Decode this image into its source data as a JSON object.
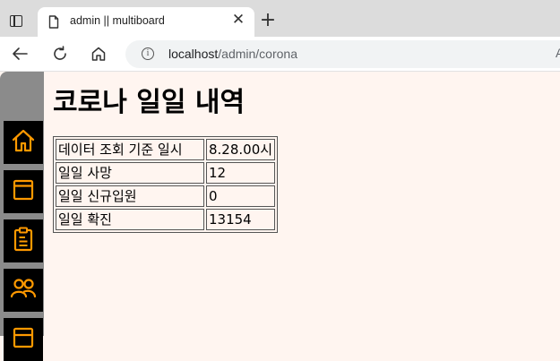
{
  "browser": {
    "tab_title": "admin || multiboard",
    "tab_close": "✕",
    "new_tab": "+",
    "url_host": "localhost",
    "url_path": "/admin/corona",
    "reader_glyph": "A"
  },
  "sidebar": {
    "items": [
      {
        "icon": "home-icon"
      },
      {
        "icon": "window-icon"
      },
      {
        "icon": "clipboard-icon"
      },
      {
        "icon": "users-icon"
      },
      {
        "icon": "board-icon"
      }
    ],
    "icon_color": "#ff9900"
  },
  "page": {
    "title": "코로나 일일 내역",
    "table": [
      {
        "label": "데이터 조회 기준 일시",
        "value": "8.28.00시"
      },
      {
        "label": "일일 사망",
        "value": "12"
      },
      {
        "label": "일일 신규입원",
        "value": "0"
      },
      {
        "label": "일일 확진",
        "value": "13154"
      }
    ]
  },
  "colors": {
    "page_background": "#fff5f0",
    "sidebar_background": "#8b8b8b",
    "sidebar_item_background": "#000000",
    "accent": "#ff9900"
  }
}
